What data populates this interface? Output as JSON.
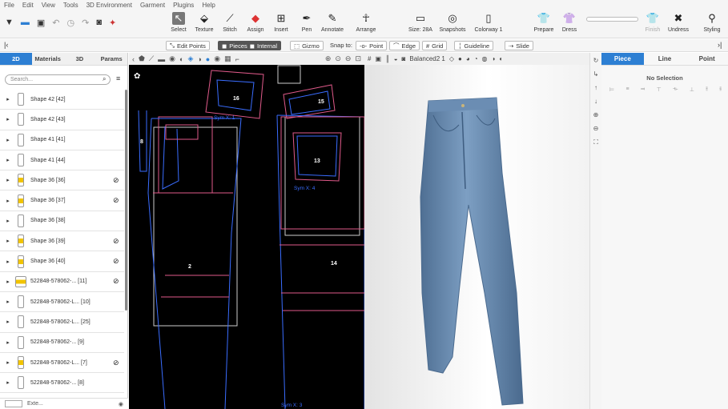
{
  "menu": [
    "File",
    "Edit",
    "View",
    "Tools",
    "3D Environment",
    "Garment",
    "Plugins",
    "Help"
  ],
  "toolbar": {
    "select": "Select",
    "texture": "Texture",
    "stitch": "Stitch",
    "assign": "Assign",
    "insert": "Insert",
    "pen": "Pen",
    "annotate": "Annotate",
    "arrange": "Arrange",
    "size": "Size: 28A",
    "snapshots": "Snapshots",
    "colorway": "Colorway 1",
    "prepare": "Prepare",
    "dress": "Dress",
    "finish": "Finish",
    "undress": "Undress",
    "styling": "Styling"
  },
  "subbar": {
    "edit_points": "Edit Points",
    "pieces": "Pieces",
    "internal": "Internal",
    "gizmo": "Gizmo",
    "snap_to": "Snap to:",
    "point": "Point",
    "edge": "Edge",
    "grid": "Grid",
    "guideline": "Guideline",
    "slide": "Slide"
  },
  "sidebar": {
    "tabs": [
      "2D",
      "Materials",
      "3D",
      "Params"
    ],
    "search_placeholder": "Search...",
    "items": [
      {
        "label": "Shape 42 [42]",
        "thumb": "plain",
        "hidden": false
      },
      {
        "label": "Shape 42 [43]",
        "thumb": "plain",
        "hidden": false
      },
      {
        "label": "Shape 41 [41]",
        "thumb": "plain",
        "hidden": false
      },
      {
        "label": "Shape 41 [44]",
        "thumb": "plain",
        "hidden": false
      },
      {
        "label": "Shape 36 [36]",
        "thumb": "yel",
        "hidden": true
      },
      {
        "label": "Shape 36 [37]",
        "thumb": "yel",
        "hidden": true
      },
      {
        "label": "Shape 36 [38]",
        "thumb": "plain",
        "hidden": false
      },
      {
        "label": "Shape 36 [39]",
        "thumb": "yel",
        "hidden": true
      },
      {
        "label": "Shape 36 [40]",
        "thumb": "yel",
        "hidden": true
      },
      {
        "label": "522848-578062-...   [11]",
        "thumb": "box",
        "hidden": true
      },
      {
        "label": "522848-578062-L...  [10]",
        "thumb": "plain",
        "hidden": false
      },
      {
        "label": "522848-578062-L...  [25]",
        "thumb": "plain",
        "hidden": false
      },
      {
        "label": "522848-578062-...   [9]",
        "thumb": "plain",
        "hidden": false
      },
      {
        "label": "522848-578062-L...  [7]",
        "thumb": "yel",
        "hidden": true
      },
      {
        "label": "522848-578062-...   [8]",
        "thumb": "plain",
        "hidden": false
      }
    ],
    "bottom_label": "Exte..."
  },
  "view2d": {
    "pieces": [
      "16",
      "15",
      "13",
      "2",
      "14",
      "8"
    ],
    "sym_labels": [
      "Sym X: 1",
      "Sym X: 4",
      "Sym X: 3"
    ]
  },
  "view3d": {
    "avatar_label": "Balanced2 1"
  },
  "properties": {
    "tabs": [
      "Piece",
      "Line",
      "Point"
    ],
    "no_selection": "No Selection"
  }
}
